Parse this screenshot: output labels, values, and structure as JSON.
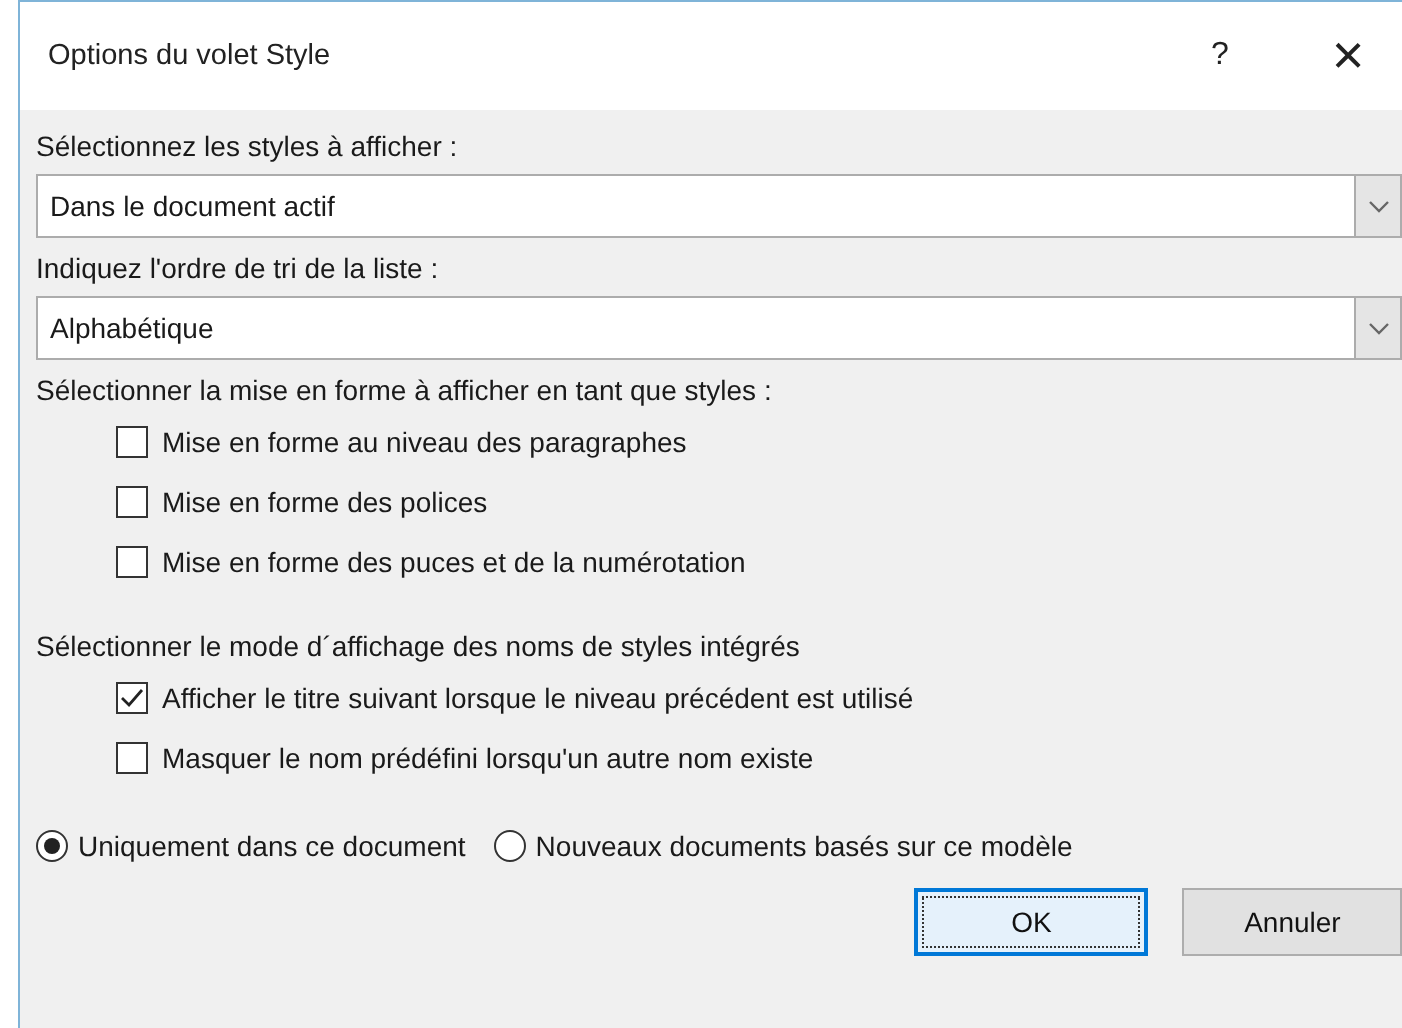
{
  "window": {
    "title": "Options du volet Style",
    "help": "?",
    "close": "×"
  },
  "styles_to_show": {
    "label": "Sélectionnez les styles à afficher :",
    "value": "Dans le document actif"
  },
  "sort_order": {
    "label": "Indiquez l'ordre de tri de la liste :",
    "value": "Alphabétique"
  },
  "formatting": {
    "label": "Sélectionner la mise en forme à afficher en tant que styles :",
    "options": [
      {
        "label": "Mise en forme au niveau des paragraphes",
        "checked": false
      },
      {
        "label": "Mise en forme des polices",
        "checked": false
      },
      {
        "label": "Mise en forme des puces et de la numérotation",
        "checked": false
      }
    ]
  },
  "builtin_names": {
    "label": "Sélectionner le mode d´affichage des noms de styles intégrés",
    "options": [
      {
        "label": "Afficher le titre suivant lorsque le niveau précédent est utilisé",
        "checked": true
      },
      {
        "label": "Masquer le nom prédéfini lorsqu'un autre nom existe",
        "checked": false
      }
    ]
  },
  "scope": [
    {
      "label": "Uniquement dans ce document",
      "selected": true
    },
    {
      "label": "Nouveaux documents basés sur ce modèle",
      "selected": false
    }
  ],
  "buttons": [
    {
      "label": "OK",
      "default": true
    },
    {
      "label": "Annuler",
      "default": false
    }
  ]
}
